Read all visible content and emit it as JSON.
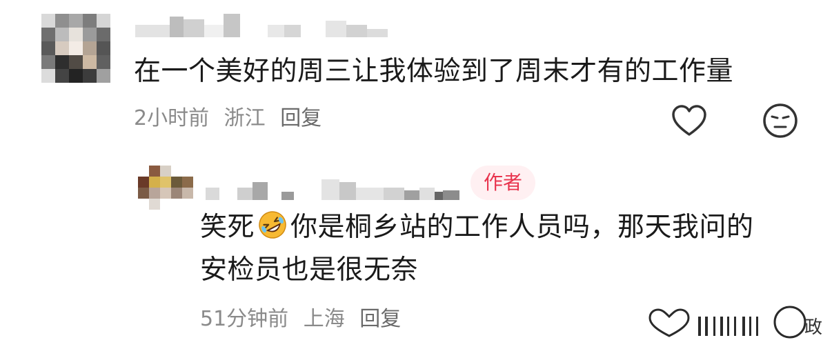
{
  "comments": [
    {
      "text": "在一个美好的周三让我体验到了周末才有的工作量",
      "time": "2小时前",
      "location": "浙江",
      "reply_label": "回复",
      "icons": [
        "heart-icon",
        "neutral-face-icon"
      ]
    }
  ],
  "reply": {
    "badge": "作者",
    "text_before_emoji": "笑死",
    "emoji": "rolling-on-floor-laughing-icon",
    "text_line1_after_emoji": "你是桐乡站的工作人员吗，那天我问的",
    "text_line2": "安检员也是很无奈",
    "time": "51分钟前",
    "location": "上海",
    "reply_label": "回复"
  },
  "colors": {
    "text": "#1a1a1a",
    "meta": "#8a8a8a",
    "badge_text": "#e8344e",
    "badge_bg": "#fff0f2"
  }
}
